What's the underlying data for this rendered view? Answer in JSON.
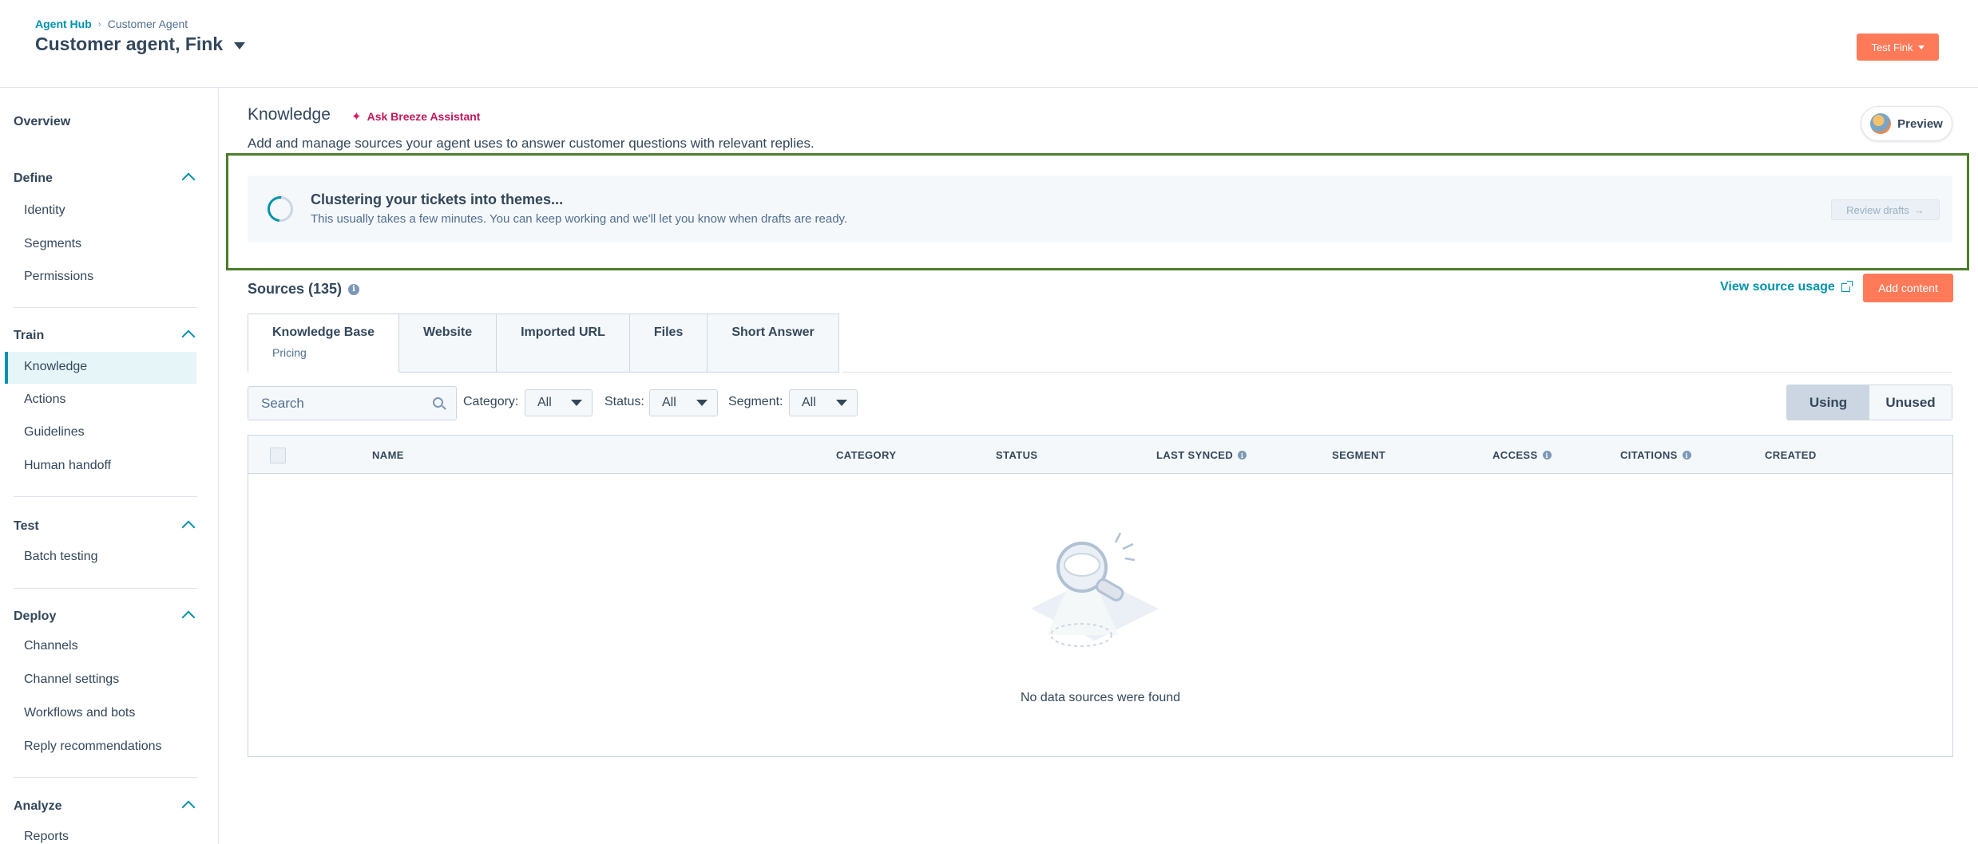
{
  "header": {
    "breadcrumb_root": "Agent Hub",
    "breadcrumb_sep": "›",
    "breadcrumb_current": "Customer Agent",
    "agent_name": "Customer agent, Fink",
    "user_button": "Test Fink"
  },
  "sidebar": {
    "overview": "Overview",
    "sections": [
      {
        "title": "Define",
        "items": [
          "Identity",
          "Segments",
          "Permissions"
        ]
      },
      {
        "title": "Train",
        "items": [
          "Knowledge",
          "Actions",
          "Guidelines",
          "Human handoff"
        ]
      },
      {
        "title": "Test",
        "items": [
          "Batch testing"
        ]
      },
      {
        "title": "Deploy",
        "items": [
          "Channels",
          "Channel settings",
          "Workflows and bots",
          "Reply recommendations"
        ]
      },
      {
        "title": "Analyze",
        "items": [
          "Reports"
        ]
      }
    ],
    "active_item": "Knowledge"
  },
  "main": {
    "title": "Knowledge",
    "breeze_label": "Ask Breeze Assistant",
    "subtitle": "Add and manage sources your agent uses to answer customer questions with relevant replies.",
    "preview_label": "Preview"
  },
  "banner": {
    "title": "Clustering your tickets into themes...",
    "text": "This usually takes a few minutes. You can keep working and we'll let you know when drafts are ready.",
    "review_label": "Review drafts",
    "review_arrow": "→"
  },
  "sources": {
    "title": "Sources (135)",
    "info_glyph": "i",
    "view_usage": "View source usage",
    "add_content": "Add content"
  },
  "tabs": [
    {
      "label": "Knowledge Base",
      "sub": "Pricing"
    },
    {
      "label": "Website",
      "sub": ""
    },
    {
      "label": "Imported URL",
      "sub": ""
    },
    {
      "label": "Files",
      "sub": ""
    },
    {
      "label": "Short Answer",
      "sub": ""
    }
  ],
  "filters": {
    "search_placeholder": "Search",
    "category_label": "Category:",
    "category_value": "All",
    "status_label": "Status:",
    "status_value": "All",
    "segment_label": "Segment:",
    "segment_value": "All",
    "toggle_using": "Using",
    "toggle_unused": "Unused"
  },
  "table": {
    "columns": [
      "NAME",
      "CATEGORY",
      "STATUS",
      "LAST SYNCED",
      "SEGMENT",
      "ACCESS",
      "CITATIONS",
      "CREATED"
    ],
    "empty_text": "No data sources were found"
  },
  "colors": {
    "accent": "#0091ae",
    "cta": "#ff7a59",
    "highlight_border": "#4b7d2c",
    "breeze": "#c2185b"
  }
}
